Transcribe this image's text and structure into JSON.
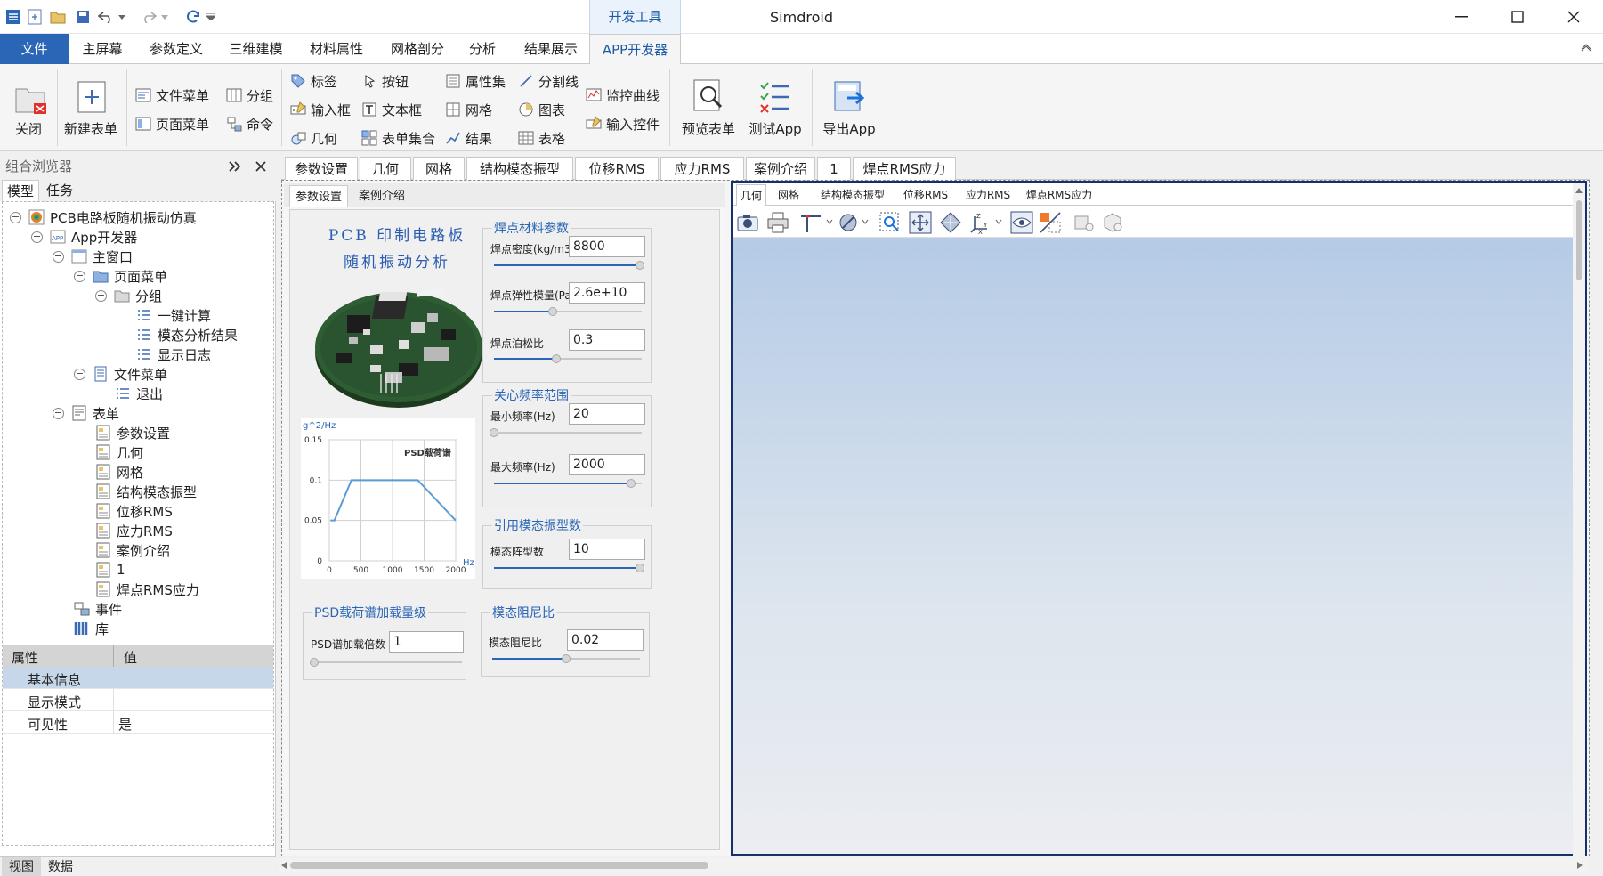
{
  "window": {
    "title": "Simdroid",
    "context_tab": "开发工具"
  },
  "menu": {
    "tabs": [
      "文件",
      "主屏幕",
      "参数定义",
      "三维建模",
      "材料属性",
      "网格剖分",
      "分析",
      "结果展示",
      "APP开发器"
    ],
    "active": "APP开发器"
  },
  "ribbon": {
    "close": "关闭",
    "new_form": "新建表单",
    "file_menu": "文件菜单",
    "page_menu": "页面菜单",
    "group": "分组",
    "command": "命令",
    "label": "标签",
    "input_box": "输入框",
    "geometry": "几何",
    "button": "按钮",
    "text_box": "文本框",
    "form_set": "表单集合",
    "property_set": "属性集",
    "mesh": "网格",
    "result": "结果",
    "divider": "分割线",
    "chart": "图表",
    "table": "表格",
    "monitor_curve": "监控曲线",
    "input_control": "输入控件",
    "preview_form": "预览表单",
    "test_app": "测试App",
    "export_app": "导出App"
  },
  "browser": {
    "title": "组合浏览器",
    "tab_model": "模型",
    "tab_task": "任务",
    "tree": {
      "root": "PCB电路板随机振动仿真",
      "app_dev": "App开发器",
      "main_window": "主窗口",
      "page_menu": "页面菜单",
      "group": "分组",
      "one_click": "一键计算",
      "modal_result": "模态分析结果",
      "show_log": "显示日志",
      "file_menu": "文件菜单",
      "exit": "退出",
      "forms": "表单",
      "form_items": [
        "参数设置",
        "几何",
        "网格",
        "结构模态振型",
        "位移RMS",
        "应力RMS",
        "案例介绍",
        "1",
        "焊点RMS应力"
      ],
      "events": "事件",
      "library": "库"
    },
    "props": {
      "col_attr": "属性",
      "col_val": "值",
      "section": "基本信息",
      "rows": [
        {
          "name": "显示模式",
          "value": ""
        },
        {
          "name": "可见性",
          "value": "是"
        }
      ]
    },
    "bottom_tabs": [
      "视图",
      "数据"
    ]
  },
  "form_tabs": [
    "参数设置",
    "几何",
    "网格",
    "结构模态振型",
    "位移RMS",
    "应力RMS",
    "案例介绍",
    "1",
    "焊点RMS应力"
  ],
  "param_page": {
    "tabs": [
      "参数设置",
      "案例介绍"
    ],
    "title_line1": "PCB 印制电路板",
    "title_line2": "随机振动分析",
    "solder_group": {
      "title": "焊点材料参数",
      "density_label": "焊点密度(kg/m3)",
      "density": "8800",
      "density_pos": 0.99,
      "modulus_label": "焊点弹性模量(Pa)",
      "modulus": "2.6e+10",
      "modulus_pos": 0.4,
      "poisson_label": "焊点泊松比",
      "poisson": "0.3",
      "poisson_pos": 0.42
    },
    "freq_group": {
      "title": "关心频率范围",
      "min_label": "最小频率(Hz)",
      "min": "20",
      "min_pos": 0.0,
      "max_label": "最大频率(Hz)",
      "max": "2000",
      "max_pos": 0.93
    },
    "modes_group": {
      "title": "引用模态振型数",
      "label": "模态阵型数",
      "value": "10",
      "pos": 0.99
    },
    "psd_group": {
      "title": "PSD载荷谱加载量级",
      "label": "PSD谱加载倍数",
      "value": "1",
      "pos": 0.0
    },
    "damp_group": {
      "title": "模态阻尼比",
      "label": "模态阻尼比",
      "value": "0.02",
      "pos": 0.5
    }
  },
  "chart_data": {
    "type": "line",
    "title": "PSD载荷谱",
    "xlabel": "Hz",
    "ylabel": "g^2/Hz",
    "x": [
      20,
      80,
      350,
      1400,
      2000
    ],
    "y": [
      0.05,
      0.05,
      0.1,
      0.1,
      0.05
    ],
    "xlim": [
      0,
      2000
    ],
    "ylim": [
      0,
      0.15
    ],
    "xticks": [
      "0",
      "500",
      "1000",
      "1500",
      "2000"
    ],
    "yticks": [
      "0",
      "0.05",
      "0.1",
      "0.15"
    ],
    "grid": true,
    "color": "#5b9bd5"
  },
  "viewer": {
    "tabs": [
      "几何",
      "网格",
      "结构模态振型",
      "位移RMS",
      "应力RMS",
      "焊点RMS应力"
    ],
    "active": "几何",
    "tools": [
      "camera-icon",
      "print-icon",
      "axis-icon",
      "section-icon",
      "zoom-box-icon",
      "pan-icon",
      "fit-icon",
      "triad-icon",
      "eye-icon",
      "clip-icon",
      "light-icon",
      "cube-icon"
    ]
  },
  "colors": {
    "accent": "#2a65b6",
    "viewer_border": "#16306b"
  }
}
